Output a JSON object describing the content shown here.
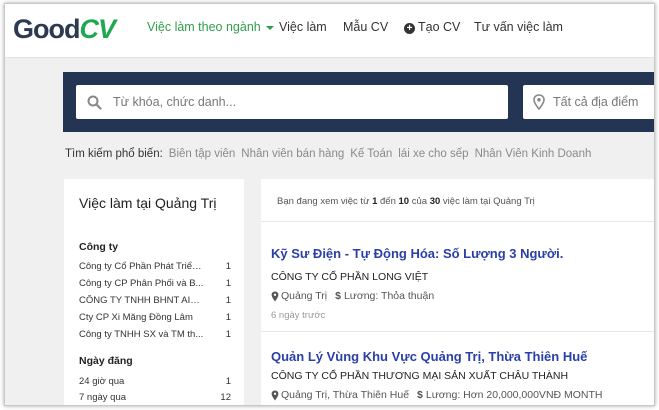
{
  "logo": {
    "part1": "Good",
    "part2": "CV"
  },
  "nav": {
    "items": [
      {
        "label": "Việc làm theo ngành"
      },
      {
        "label": "Việc làm"
      },
      {
        "label": "Mẫu CV"
      },
      {
        "label": "Tạo CV"
      },
      {
        "label": "Tư vấn việc làm"
      }
    ]
  },
  "search": {
    "keyword_placeholder": "Từ khóa, chức danh...",
    "location_placeholder": "Tất cả địa điểm"
  },
  "popular": {
    "label": "Tìm kiếm phổ biến:",
    "tags": [
      "Biên tập viên",
      "Nhân viên bán hàng",
      "Kế Toán",
      "lái xe cho sếp",
      "Nhân Viên Kinh Doanh"
    ]
  },
  "sidebar": {
    "title": "Việc làm tại Quảng Trị",
    "company_heading": "Công ty",
    "companies": [
      {
        "name": "Công ty Cổ Phần Phát Triển...",
        "count": "1"
      },
      {
        "name": "Công ty CP Phân Phối và B...",
        "count": "1"
      },
      {
        "name": "CÔNG TY TNHH BHNT AIA ...",
        "count": "1"
      },
      {
        "name": "Cty CP Xi Măng Đồng Lâm",
        "count": "1"
      },
      {
        "name": "Công ty TNHH SX và TM th...",
        "count": "1"
      }
    ],
    "date_heading": "Ngày đăng",
    "dates": [
      {
        "name": "24 giờ qua",
        "count": "1"
      },
      {
        "name": "7 ngày qua",
        "count": "12"
      }
    ]
  },
  "results": {
    "prefix": "Bạn đang xem việc từ",
    "from": "1",
    "mid1": "đến",
    "to": "10",
    "mid2": "của",
    "total": "30",
    "suffix": "việc làm tại Quảng Trị"
  },
  "jobs": [
    {
      "title": "Kỹ Sư Điện - Tự Động Hóa: Số Lượng 3 Người.",
      "company": "CÔNG TY CỔ PHẦN LONG VIỆT",
      "location": "Quảng Trị",
      "salary": "Lương: Thỏa thuận",
      "posted": "6 ngày trước"
    },
    {
      "title": "Quản Lý Vùng Khu Vực Quảng Trị, Thừa Thiên Huế",
      "company": "CÔNG TY CỔ PHẦN THƯƠNG MẠI SẢN XUẤT CHÂU THÀNH",
      "location": "Quảng Trị, Thừa Thiên Huế",
      "salary": "Lương: Hơn 20,000,000VNĐ MONTH",
      "posted": ""
    }
  ],
  "colors": {
    "nav_active": "#2e9e4a",
    "search_bg": "#243553",
    "job_title": "#2a3fa8"
  }
}
